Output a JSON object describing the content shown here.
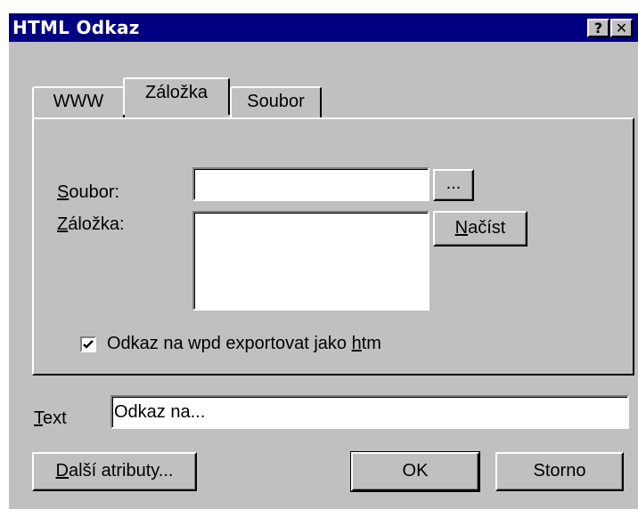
{
  "window": {
    "title": "HTML Odkaz",
    "help_label": "?",
    "close_label": "✕"
  },
  "tabs": [
    {
      "label": "WWW",
      "active": false
    },
    {
      "label": "Záložka",
      "active": true
    },
    {
      "label": "Soubor",
      "active": false
    }
  ],
  "panel": {
    "soubor_label_mnemonic": "S",
    "soubor_label_rest": "oubor:",
    "soubor_value": "",
    "browse_label": "...",
    "zalozka_label_mnemonic": "Z",
    "zalozka_label_rest": "áložka:",
    "zalozka_value": "",
    "load_label_mnemonic": "N",
    "load_label_rest": "ačíst",
    "export_checkbox_checked": true,
    "export_label_prefix": "Odkaz na wpd exportovat jako ",
    "export_label_mnemonic": "h",
    "export_label_rest": "tm"
  },
  "text_field": {
    "label_mnemonic": "T",
    "label_rest": "ext",
    "value": "Odkaz na..."
  },
  "buttons": {
    "more_mnemonic": "D",
    "more_rest": "alší atributy...",
    "ok_label": "OK",
    "cancel_label": "Storno"
  }
}
